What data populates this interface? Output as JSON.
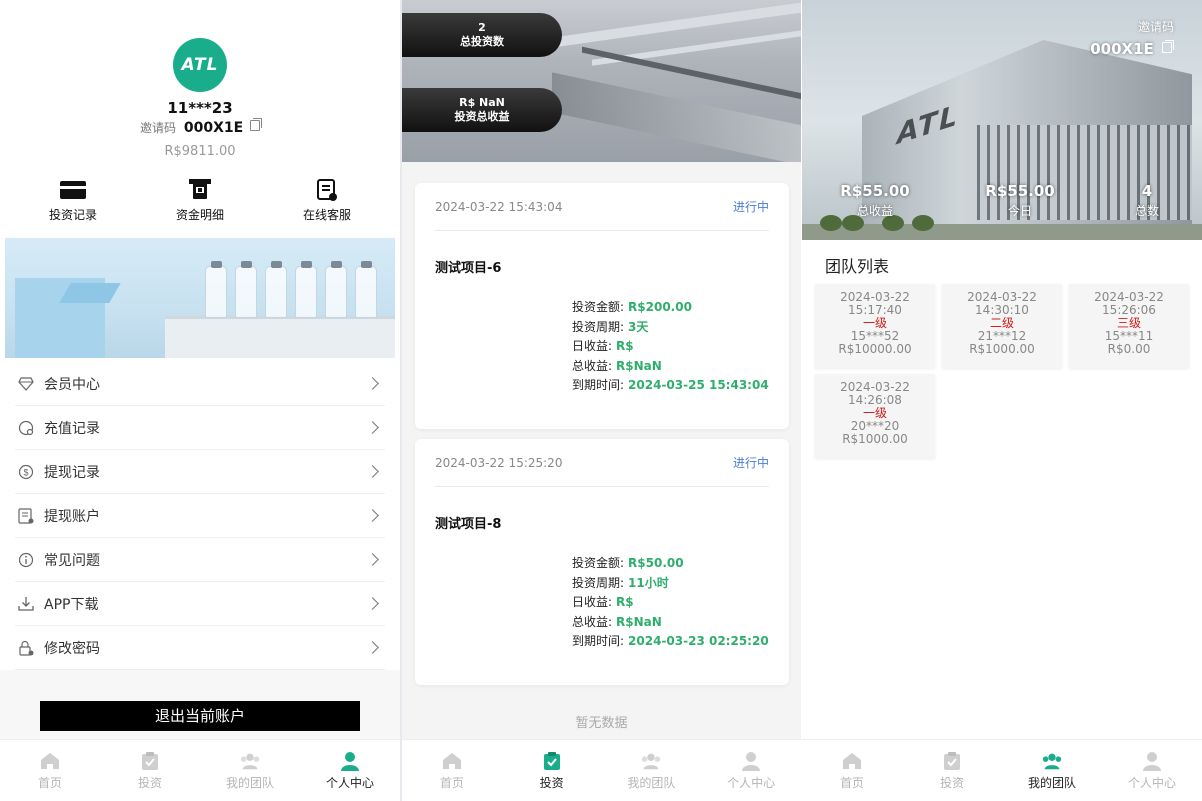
{
  "profile": {
    "avatar_text": "ATL",
    "username": "11***23",
    "invite_label": "邀请码",
    "invite_code": "000X1E",
    "balance": "R$9811.00"
  },
  "quick_actions": [
    {
      "label": "投资记录",
      "icon": "card-icon"
    },
    {
      "label": "资金明细",
      "icon": "wallet-icon"
    },
    {
      "label": "在线客服",
      "icon": "document-icon"
    }
  ],
  "menu": [
    {
      "label": "会员中心",
      "icon": "diamond-icon"
    },
    {
      "label": "充值记录",
      "icon": "recharge-icon"
    },
    {
      "label": "提现记录",
      "icon": "dollar-icon"
    },
    {
      "label": "提现账户",
      "icon": "account-icon"
    },
    {
      "label": "常见问题",
      "icon": "info-icon"
    },
    {
      "label": "APP下载",
      "icon": "download-icon"
    },
    {
      "label": "修改密码",
      "icon": "lock-icon"
    }
  ],
  "logout_label": "退出当前账户",
  "tabs": [
    {
      "label": "首页",
      "icon": "home-icon"
    },
    {
      "label": "投资",
      "icon": "clipboard-icon"
    },
    {
      "label": "我的团队",
      "icon": "team-icon"
    },
    {
      "label": "个人中心",
      "icon": "user-icon"
    }
  ],
  "colors": {
    "accent": "#1aad8c",
    "value_green": "#2fae6b",
    "status_blue": "#4a7cd8",
    "level_red": "#d41c1c"
  },
  "investments": {
    "total_count": "2",
    "total_count_label": "总投资数",
    "total_income": "R$ NaN",
    "total_income_label": "投资总收益",
    "labels": {
      "amount": "投资金额:",
      "period": "投资周期:",
      "daily": "日收益:",
      "total": "总收益:",
      "expire": "到期时间:"
    },
    "items": [
      {
        "date": "2024-03-22 15:43:04",
        "status": "进行中",
        "title": "测试项目-6",
        "amount": "R$200.00",
        "period": "3天",
        "daily": "R$",
        "total": "R$NaN",
        "expire": "2024-03-25 15:43:04"
      },
      {
        "date": "2024-03-22 15:25:20",
        "status": "进行中",
        "title": "测试项目-8",
        "amount": "R$50.00",
        "period": "11小时",
        "daily": "R$",
        "total": "R$NaN",
        "expire": "2024-03-23 02:25:20"
      }
    ],
    "empty_text": "暂无数据"
  },
  "team": {
    "invite_label": "邀请码",
    "invite_code": "000X1E",
    "hero_logo": "ATL",
    "stats": [
      {
        "value": "R$55.00",
        "label": "总收益"
      },
      {
        "value": "R$55.00",
        "label": "今日"
      },
      {
        "value": "4",
        "label": "总数"
      }
    ],
    "list_title": "团队列表",
    "members": [
      {
        "date": "2024-03-22",
        "time": "15:17:40",
        "level": "一级",
        "user": "15***52",
        "amount": "R$10000.00"
      },
      {
        "date": "2024-03-22",
        "time": "14:30:10",
        "level": "二级",
        "user": "21***12",
        "amount": "R$1000.00"
      },
      {
        "date": "2024-03-22",
        "time": "15:26:06",
        "level": "三级",
        "user": "15***11",
        "amount": "R$0.00"
      },
      {
        "date": "2024-03-22",
        "time": "14:26:08",
        "level": "一级",
        "user": "20***20",
        "amount": "R$1000.00"
      }
    ]
  }
}
